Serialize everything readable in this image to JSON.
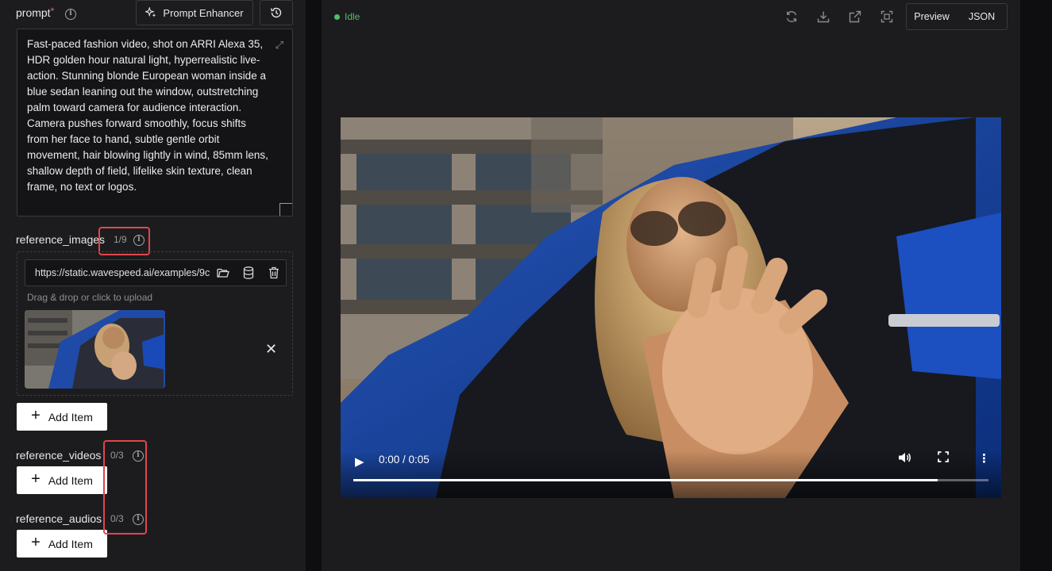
{
  "prompt": {
    "label": "prompt",
    "required_mark": "*",
    "enhancer_label": "Prompt Enhancer",
    "text": "Fast-paced fashion video, shot on ARRI Alexa 35, HDR golden hour natural light, hyperrealistic live-action. Stunning blonde European woman inside a blue sedan leaning out the window, outstretching palm toward camera for audience interaction. Camera pushes forward smoothly, focus shifts from her face to hand, subtle gentle orbit movement, hair blowing lightly in wind, 85mm lens, shallow depth of field, lifelike skin texture, clean frame, no text or logos."
  },
  "reference_images": {
    "label": "reference_images",
    "count": "1/9",
    "url_value": "https://static.wavespeed.ai/examples/9c",
    "hint": "Drag & drop or click to upload",
    "add_label": "Add Item"
  },
  "reference_videos": {
    "label": "reference_videos",
    "count": "0/3",
    "add_label": "Add Item"
  },
  "reference_audios": {
    "label": "reference_audios",
    "count": "0/3",
    "add_label": "Add Item"
  },
  "output": {
    "status": "Idle",
    "tabs": [
      "Preview",
      "JSON"
    ],
    "video": {
      "time": "0:00 / 0:05",
      "progress_fraction": 0.92
    }
  },
  "colors": {
    "status_green": "#4fbf67",
    "highlight_red": "#e2454b"
  }
}
